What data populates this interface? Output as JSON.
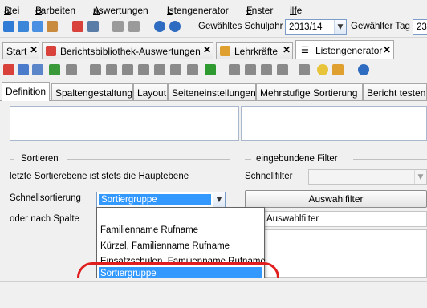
{
  "menu": [
    {
      "pre": "",
      "u": "D",
      "post": "atei"
    },
    {
      "pre": "",
      "u": "B",
      "post": "earbeiten"
    },
    {
      "pre": "",
      "u": "A",
      "post": "uswertungen"
    },
    {
      "pre": "",
      "u": "L",
      "post": "istengenerator"
    },
    {
      "pre": "",
      "u": "F",
      "post": "enster"
    },
    {
      "pre": "",
      "u": "H",
      "post": "ilfe"
    }
  ],
  "toolbar": {
    "schuljahr_label": "Gewähltes Schuljahr",
    "schuljahr_value": "2013/14",
    "tag_label": "Gewählter Tag",
    "tag_value": "23"
  },
  "tabs": [
    {
      "label": "Start"
    },
    {
      "label": "Berichtsbibliothek-Auswertungen"
    },
    {
      "label": "Lehrkräfte"
    },
    {
      "label": "Listengenerator"
    }
  ],
  "subtabs": [
    {
      "label": "Definition"
    },
    {
      "label": "Spaltengestaltung"
    },
    {
      "label": "Layout"
    },
    {
      "label": "Seiteneinstellungen"
    },
    {
      "label": "Mehrstufige Sortierung"
    },
    {
      "label": "Bericht testen"
    }
  ],
  "sort": {
    "heading": "Sortieren",
    "note": "letzte Sortierebene ist stets die Hauptebene",
    "quick_label": "Schnellsortierung",
    "quick_value": "Sortiergruppe",
    "column_label": "oder nach Spalte"
  },
  "filter": {
    "heading": "eingebundene Filter",
    "quick_label": "Schnellfilter",
    "button": "Auswahlfilter",
    "row_text": "Auswahlfilter"
  },
  "dropdown": {
    "options": [
      "",
      "Familienname Rufname",
      "Kürzel, Familienname Rufname",
      "Einsatzschulen, Familienname Rufname",
      "Sortiergruppe"
    ],
    "selected": "Sortiergruppe"
  },
  "colors": {
    "highlight": "#e01e1e",
    "selection": "#3399ff"
  }
}
